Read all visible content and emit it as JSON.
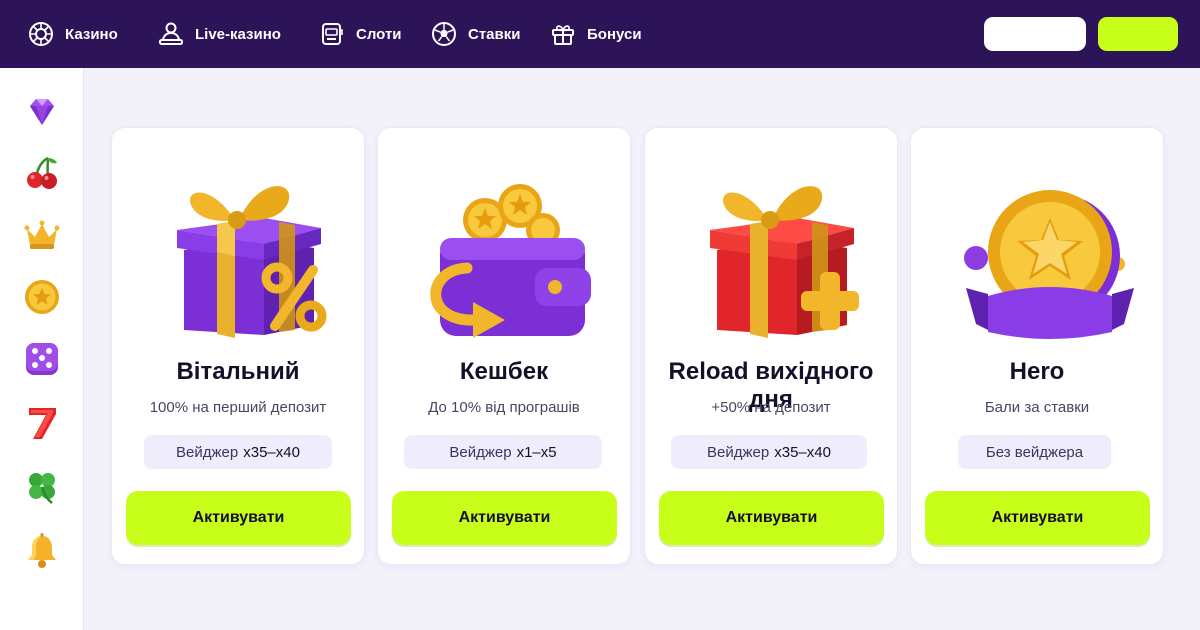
{
  "nav": {
    "items": [
      {
        "label": "Казино",
        "icon": "roulette-icon"
      },
      {
        "label": "Live-казино",
        "icon": "dealer-icon"
      },
      {
        "label": "Слоти",
        "icon": "slot-machine-icon"
      },
      {
        "label": "Ставки",
        "icon": "soccer-ball-icon"
      },
      {
        "label": "Бонуси",
        "icon": "gift-icon"
      }
    ],
    "login_label": "",
    "register_label": ""
  },
  "sidebar": {
    "items": [
      {
        "icon": "diamond-icon"
      },
      {
        "icon": "cherry-icon"
      },
      {
        "icon": "crown-icon"
      },
      {
        "icon": "star-coin-icon"
      },
      {
        "icon": "dice-icon"
      },
      {
        "icon": "seven-icon"
      },
      {
        "icon": "clover-icon"
      },
      {
        "icon": "bell-icon"
      }
    ]
  },
  "bonuses": [
    {
      "title": "Вітальний",
      "subtitle": "100% на перший депозит",
      "wager_prefix": "Вейджер",
      "wager_value": "x35–x40",
      "cta": "Активувати",
      "art": "purple-gift-percent-icon"
    },
    {
      "title": "Кешбек",
      "subtitle": "До 10% від програшів",
      "wager_prefix": "Вейджер",
      "wager_value": "x1–x5",
      "cta": "Активувати",
      "art": "wallet-coins-icon"
    },
    {
      "title": "Reload вихідного дня",
      "subtitle": "+50% на депозит",
      "wager_prefix": "Вейджер",
      "wager_value": "x35–x40",
      "cta": "Активувати",
      "art": "red-gift-plus-icon"
    },
    {
      "title": "Hero",
      "subtitle": "Бали за ставки",
      "wager_prefix": "Без вейджера",
      "wager_value": "",
      "cta": "Активувати",
      "art": "gold-star-coin-icon"
    }
  ],
  "colors": {
    "topbar": "#2d1459",
    "accent": "#c7ff1a",
    "background": "#f3f2fb",
    "badge": "#efecfb"
  }
}
